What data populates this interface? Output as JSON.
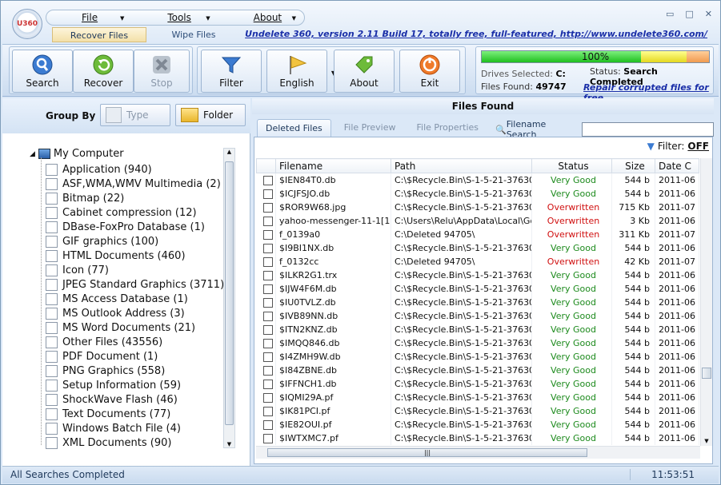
{
  "app": {
    "logo_text": "U360",
    "menus": [
      {
        "label": "File"
      },
      {
        "label": "Tools"
      },
      {
        "label": "About"
      }
    ],
    "tabs": [
      {
        "label": "Recover Files"
      },
      {
        "label": "Wipe Files"
      }
    ],
    "top_link": "Undelete 360, version 2.11 Build 17, totally free, full-featured, http://www.undelete360.com/",
    "window_buttons": {
      "min": "▭",
      "max": "□",
      "close": "✕"
    }
  },
  "toolbar": {
    "search": "Search",
    "recover": "Recover",
    "stop": "Stop",
    "filter": "Filter",
    "english": "English",
    "about": "About",
    "exit": "Exit"
  },
  "status_panel": {
    "progress_text": "100%",
    "progress": 1.0,
    "drives_label": "Drives Selected:",
    "drives_value": "C:",
    "files_label": "Files Found:",
    "files_value": "49747",
    "status_label": "Status:",
    "status_value": "Search Completed",
    "repair_link": "Repair corrupted files for free"
  },
  "left": {
    "group_by": "Group By",
    "type_btn": "Type",
    "folder_btn": "Folder",
    "root": "My Computer",
    "items": [
      {
        "label": "Application (940)",
        "icon": "app-icon"
      },
      {
        "label": "ASF,WMA,WMV Multimedia (2)",
        "icon": "media-icon"
      },
      {
        "label": "Bitmap (22)",
        "icon": "bitmap-icon"
      },
      {
        "label": "Cabinet compression (12)",
        "icon": "cab-icon"
      },
      {
        "label": "DBase-FoxPro Database (1)",
        "icon": "db-icon"
      },
      {
        "label": "GIF graphics (100)",
        "icon": "gif-icon"
      },
      {
        "label": "HTML Documents (460)",
        "icon": "html-icon"
      },
      {
        "label": "Icon (77)",
        "icon": "ico-icon"
      },
      {
        "label": "JPEG Standard Graphics (3711)",
        "icon": "jpeg-icon"
      },
      {
        "label": "MS Access Database (1)",
        "icon": "access-icon"
      },
      {
        "label": "MS Outlook Address (3)",
        "icon": "outlook-icon"
      },
      {
        "label": "MS Word Documents (21)",
        "icon": "word-icon"
      },
      {
        "label": "Other Files (43556)",
        "icon": "other-icon"
      },
      {
        "label": "PDF Document (1)",
        "icon": "pdf-icon"
      },
      {
        "label": "PNG Graphics (558)",
        "icon": "png-icon"
      },
      {
        "label": "Setup Information (59)",
        "icon": "setup-icon"
      },
      {
        "label": "ShockWave Flash (46)",
        "icon": "flash-icon"
      },
      {
        "label": "Text Documents (77)",
        "icon": "text-icon"
      },
      {
        "label": "Windows Batch File (4)",
        "icon": "batch-icon"
      },
      {
        "label": "XML Documents (90)",
        "icon": "xml-icon"
      }
    ]
  },
  "right": {
    "title": "Files Found",
    "tabs": [
      {
        "label": "Deleted Files"
      },
      {
        "label": "File Preview"
      },
      {
        "label": "File Properties"
      }
    ],
    "search_label": "Filename Search",
    "search_value": "",
    "filter_label": "Filter:",
    "filter_value": "OFF",
    "columns": [
      "Filename",
      "Path",
      "Status",
      "Size",
      "Date C"
    ],
    "rows": [
      [
        "$IEN84T0.db",
        "C:\\$Recycle.Bin\\S-1-5-21-376300...",
        "Very Good",
        "544 b",
        "2011-06"
      ],
      [
        "$ICJFSJO.db",
        "C:\\$Recycle.Bin\\S-1-5-21-376300...",
        "Very Good",
        "544 b",
        "2011-06"
      ],
      [
        "$ROR9W68.jpg",
        "C:\\$Recycle.Bin\\S-1-5-21-376300...",
        "Overwritten",
        "715 Kb",
        "2011-07"
      ],
      [
        "yahoo-messenger-11-1[1]...",
        "C:\\Users\\Relu\\AppData\\Local\\Go...",
        "Overwritten",
        "3 Kb",
        "2011-06"
      ],
      [
        "f_0139a0",
        "C:\\Deleted 94705\\",
        "Overwritten",
        "311 Kb",
        "2011-07"
      ],
      [
        "$I9BI1NX.db",
        "C:\\$Recycle.Bin\\S-1-5-21-376300...",
        "Very Good",
        "544 b",
        "2011-06"
      ],
      [
        "f_0132cc",
        "C:\\Deleted 94705\\",
        "Overwritten",
        "42 Kb",
        "2011-07"
      ],
      [
        "$ILKR2G1.trx",
        "C:\\$Recycle.Bin\\S-1-5-21-376300...",
        "Very Good",
        "544 b",
        "2011-06"
      ],
      [
        "$IJW4F6M.db",
        "C:\\$Recycle.Bin\\S-1-5-21-376300...",
        "Very Good",
        "544 b",
        "2011-06"
      ],
      [
        "$IU0TVLZ.db",
        "C:\\$Recycle.Bin\\S-1-5-21-376300...",
        "Very Good",
        "544 b",
        "2011-06"
      ],
      [
        "$IVB89NN.db",
        "C:\\$Recycle.Bin\\S-1-5-21-376300...",
        "Very Good",
        "544 b",
        "2011-06"
      ],
      [
        "$ITN2KNZ.db",
        "C:\\$Recycle.Bin\\S-1-5-21-376300...",
        "Very Good",
        "544 b",
        "2011-06"
      ],
      [
        "$IMQQ846.db",
        "C:\\$Recycle.Bin\\S-1-5-21-376300...",
        "Very Good",
        "544 b",
        "2011-06"
      ],
      [
        "$I4ZMH9W.db",
        "C:\\$Recycle.Bin\\S-1-5-21-376300...",
        "Very Good",
        "544 b",
        "2011-06"
      ],
      [
        "$I84ZBNE.db",
        "C:\\$Recycle.Bin\\S-1-5-21-376300...",
        "Very Good",
        "544 b",
        "2011-06"
      ],
      [
        "$IFFNCH1.db",
        "C:\\$Recycle.Bin\\S-1-5-21-376300...",
        "Very Good",
        "544 b",
        "2011-06"
      ],
      [
        "$IQMI29A.pf",
        "C:\\$Recycle.Bin\\S-1-5-21-376300...",
        "Very Good",
        "544 b",
        "2011-06"
      ],
      [
        "$IK81PCI.pf",
        "C:\\$Recycle.Bin\\S-1-5-21-376300...",
        "Very Good",
        "544 b",
        "2011-06"
      ],
      [
        "$IE82OUI.pf",
        "C:\\$Recycle.Bin\\S-1-5-21-376300...",
        "Very Good",
        "544 b",
        "2011-06"
      ],
      [
        "$IWTXMC7.pf",
        "C:\\$Recycle.Bin\\S-1-5-21-376300...",
        "Very Good",
        "544 b",
        "2011-06"
      ]
    ]
  },
  "statusbar": {
    "left": "All Searches Completed",
    "time": "11:53:51"
  },
  "colors": {
    "good": "#1c8a1c",
    "overwritten": "#d01010",
    "progress_green": "#27d427",
    "progress_yellow": "#e8e840",
    "progress_orange": "#f4a460"
  }
}
